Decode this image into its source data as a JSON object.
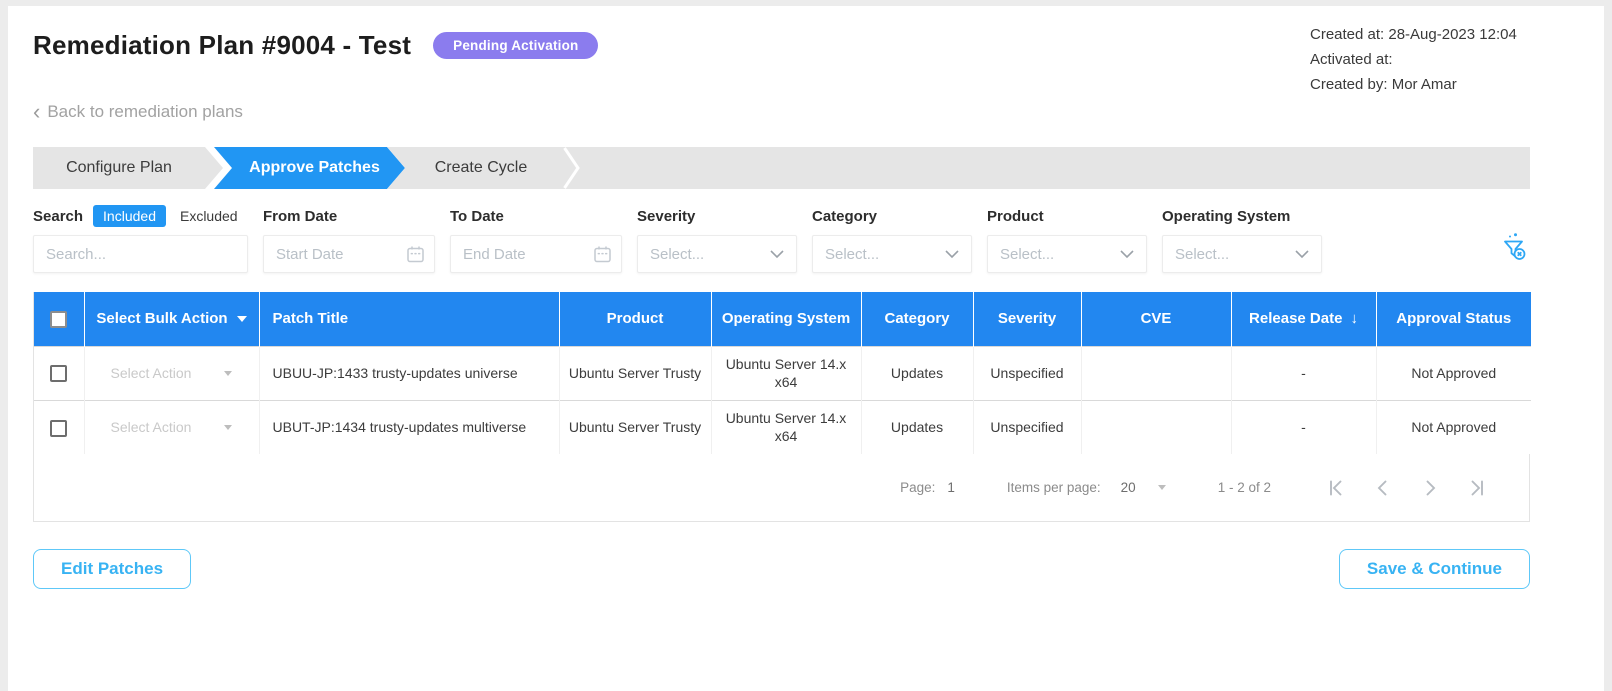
{
  "header": {
    "title": "Remediation Plan #9004 - Test",
    "status_badge": "Pending Activation",
    "meta": [
      "Created at: 28-Aug-2023 12:04",
      "Activated at:",
      "Created by: Mor Amar"
    ],
    "back_chevron": "‹",
    "back_label": "Back to remediation plans"
  },
  "wizard": {
    "steps": [
      {
        "label": "Configure Plan",
        "state": "inactive"
      },
      {
        "label": "Approve Patches",
        "state": "active"
      },
      {
        "label": "Create Cycle",
        "state": "inactive"
      }
    ]
  },
  "filters": {
    "search_label": "Search",
    "included_toggle": "Included",
    "excluded_toggle": "Excluded",
    "search_placeholder": "Search...",
    "from_date_label": "From Date",
    "from_date_placeholder": "Start Date",
    "to_date_label": "To Date",
    "to_date_placeholder": "End Date",
    "severity_label": "Severity",
    "category_label": "Category",
    "product_label": "Product",
    "operating_system_label": "Operating System",
    "select_placeholder": "Select..."
  },
  "table": {
    "bulk_action_header": "Select Bulk Action",
    "columns": [
      "Patch Title",
      "Product",
      "Operating System",
      "Category",
      "Severity",
      "CVE",
      "Release Date",
      "Approval Status"
    ],
    "sorted_by": "Release Date",
    "sort_direction": "desc",
    "sort_indicator": "↓",
    "rows": [
      {
        "action_placeholder": "Select Action",
        "patch_title": "UBUU-JP:1433 trusty-updates universe",
        "product": "Ubuntu Server Trusty",
        "operating_system": "Ubuntu Server 14.x x64",
        "category": "Updates",
        "severity": "Unspecified",
        "cve": "",
        "release_date": "-",
        "approval_status": "Not Approved"
      },
      {
        "action_placeholder": "Select Action",
        "patch_title": "UBUT-JP:1434 trusty-updates multiverse",
        "product": "Ubuntu Server Trusty",
        "operating_system": "Ubuntu Server 14.x x64",
        "category": "Updates",
        "severity": "Unspecified",
        "cve": "",
        "release_date": "-",
        "approval_status": "Not Approved"
      }
    ]
  },
  "pagination": {
    "page_label": "Page:",
    "page_value": "1",
    "items_per_page_label": "Items per page:",
    "items_per_page_value": "20",
    "range_text": "1 - 2 of 2"
  },
  "footer": {
    "edit_patches_label": "Edit Patches",
    "save_continue_label": "Save & Continue"
  },
  "colors": {
    "table_header_blue": "#2287f0",
    "step_active_blue": "#2196f3",
    "toggle_active_blue": "#2196f3",
    "badge_purple": "#8b7cee",
    "button_blue": "#38b3f3",
    "funnel_blue": "#2ea7f5"
  }
}
